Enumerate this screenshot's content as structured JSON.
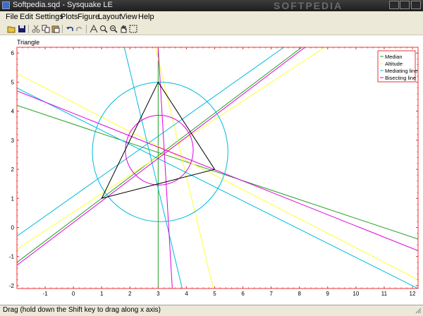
{
  "window": {
    "title": "Softpedia.sqd - Sysquake LE",
    "watermark": "SOFTPEDIA"
  },
  "menu": [
    "File",
    "Edit",
    "Settings",
    "Plots",
    "Figure",
    "Layout",
    "View",
    "Help"
  ],
  "toolbar": {
    "buttons": [
      "open-icon",
      "save-icon",
      "cut-icon",
      "copy-icon",
      "paste-icon",
      "undo-icon",
      "redo-icon",
      "drag-icon",
      "zoom-in-icon",
      "zoom-out-icon",
      "pan-icon",
      "select-icon"
    ]
  },
  "plot": {
    "title": "Triangle"
  },
  "chart_data": {
    "type": "line",
    "title": "Triangle",
    "xlim": [
      -2,
      12.2
    ],
    "ylim": [
      -2.1,
      6.2
    ],
    "xticks": [
      -1,
      0,
      1,
      2,
      3,
      4,
      5,
      6,
      7,
      8,
      9,
      10,
      11,
      12
    ],
    "yticks": [
      -2,
      -1,
      0,
      1,
      2,
      3,
      4,
      5,
      6
    ],
    "triangle": [
      [
        3,
        5
      ],
      [
        1,
        1
      ],
      [
        5,
        2
      ]
    ],
    "circumcircle": {
      "center": [
        3.07,
        2.6
      ],
      "radius": 2.4
    },
    "incircle": {
      "center": [
        3.04,
        2.66
      ],
      "radius": 1.2
    },
    "legend": [
      {
        "label": "Median",
        "color": "#22a022"
      },
      {
        "label": "Altitude",
        "color": "#ffff33"
      },
      {
        "label": "Mediating line",
        "color": "#00bbdd"
      },
      {
        "label": "Bisecting line",
        "color": "#dd00dd"
      }
    ],
    "legend_position": "top-right",
    "grid": false,
    "series": [
      {
        "name": "Median",
        "color": "#22a022",
        "lines": [
          [
            [
              3,
              -2.1
            ],
            [
              3,
              6.2
            ]
          ],
          [
            [
              -2,
              4.2
            ],
            [
              12.2,
              -0.4
            ]
          ],
          [
            [
              -2,
              -1.2
            ],
            [
              8.09,
              6.2
            ]
          ]
        ]
      },
      {
        "name": "Altitude",
        "color": "#ffff33",
        "lines": [
          [
            [
              2.9,
              6.2
            ],
            [
              4.95,
              -2.1
            ]
          ],
          [
            [
              -2,
              5.3
            ],
            [
              12.2,
              -1.8
            ]
          ],
          [
            [
              -2,
              -0.75
            ],
            [
              8.9,
              6.2
            ]
          ]
        ]
      },
      {
        "name": "Mediating line",
        "color": "#00bbdd",
        "lines": [
          [
            [
              1.8,
              6.2
            ],
            [
              3.85,
              -2.1
            ]
          ],
          [
            [
              -2,
              4.8
            ],
            [
              12.2,
              -2.1
            ]
          ],
          [
            [
              -2,
              -0.3
            ],
            [
              7.45,
              6.2
            ]
          ]
        ]
      },
      {
        "name": "Bisecting line",
        "color": "#dd00dd",
        "lines": [
          [
            [
              3.0,
              6.2
            ],
            [
              3.5,
              -2.1
            ]
          ],
          [
            [
              -2,
              4.7
            ],
            [
              12.2,
              -0.8
            ]
          ],
          [
            [
              -2,
              -1.3
            ],
            [
              8.2,
              6.2
            ]
          ]
        ]
      }
    ]
  },
  "status": {
    "text": "Drag (hold down the Shift key to drag along x axis)"
  }
}
